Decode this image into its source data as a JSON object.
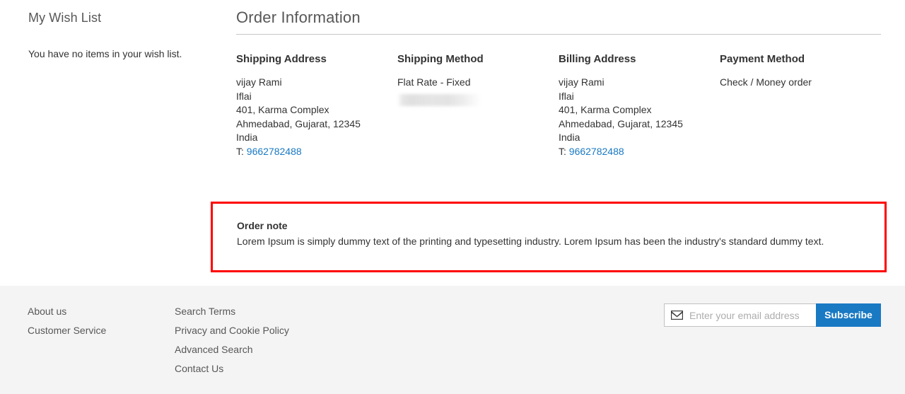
{
  "sidebar": {
    "title": "My Wish List",
    "empty_message": "You have no items in your wish list."
  },
  "order_information": {
    "title": "Order Information",
    "columns": [
      {
        "heading": "Shipping Address",
        "name": "vijay Rami",
        "company": "Iflai",
        "street": "401, Karma Complex",
        "city_region_zip": "Ahmedabad, Gujarat, 12345",
        "country": "India",
        "phone_label": "T:",
        "phone": "9662782488"
      },
      {
        "heading": "Shipping Method",
        "method": "Flat Rate - Fixed",
        "redacted_value": ""
      },
      {
        "heading": "Billing Address",
        "name": "vijay Rami",
        "company": "Iflai",
        "street": "401, Karma Complex",
        "city_region_zip": "Ahmedabad, Gujarat, 12345",
        "country": "India",
        "phone_label": "T:",
        "phone": "9662782488"
      },
      {
        "heading": "Payment Method",
        "method": "Check / Money order"
      }
    ]
  },
  "order_note": {
    "label": "Order note",
    "text": "Lorem Ipsum is simply dummy text of the printing and typesetting industry. Lorem Ipsum has been the industry's standard dummy text.",
    "highlight_color": "#ff0000"
  },
  "footer": {
    "links_column_1": [
      {
        "label": "About us"
      },
      {
        "label": "Customer Service"
      }
    ],
    "links_column_2": [
      {
        "label": "Search Terms"
      },
      {
        "label": "Privacy and Cookie Policy"
      },
      {
        "label": "Advanced Search"
      },
      {
        "label": "Contact Us"
      }
    ],
    "newsletter": {
      "icon": "envelope-icon",
      "placeholder": "Enter your email address",
      "value": "",
      "button_label": "Subscribe",
      "button_color": "#1979c3"
    }
  },
  "theme": {
    "link_color": "#1979c3",
    "text_color": "#333333",
    "muted_text_color": "#575757",
    "footer_bg": "#f4f4f4",
    "rule_color": "#c6c6c6"
  }
}
